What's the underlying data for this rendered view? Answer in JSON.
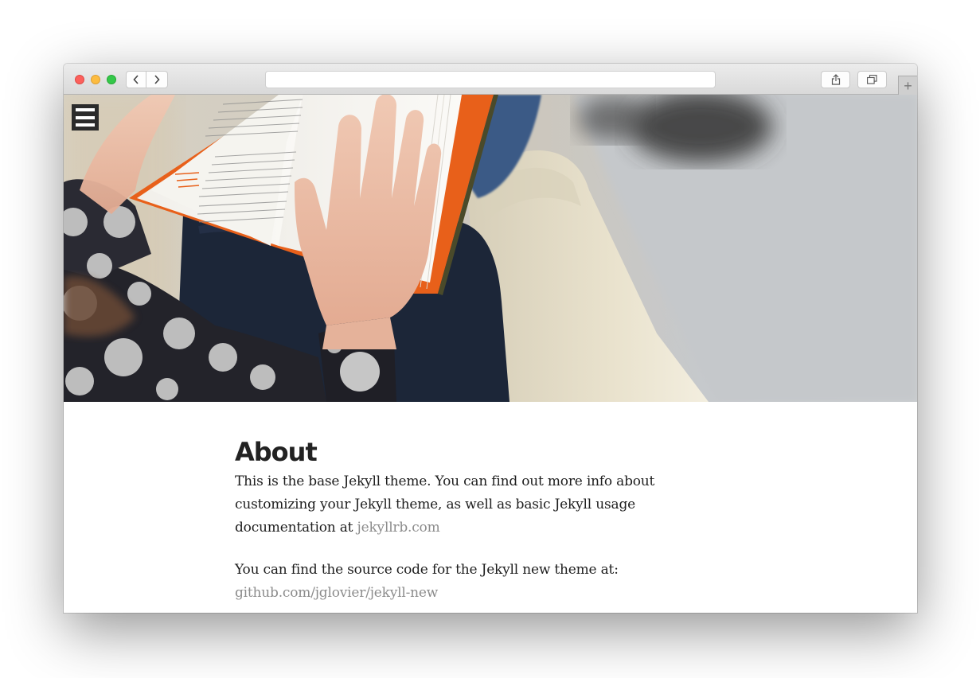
{
  "browser": {
    "address": "",
    "new_tab_symbol": "+",
    "back_icon": "chevron-left-icon",
    "forward_icon": "chevron-right-icon",
    "share_icon": "share-icon",
    "tabs_icon": "tabs-overview-icon"
  },
  "hero": {
    "image": "photo of a person reading an open book with an orange cover, sitting on a cream sofa"
  },
  "nav": {
    "menu_icon": "hamburger-menu-icon"
  },
  "article": {
    "title": "About",
    "p1_text": "This is the base Jekyll theme. You can find out more info about customizing your Jekyll theme, as well as basic Jekyll usage documentation at ",
    "p1_link": "jekyllrb.com",
    "p2_text": "You can find the source code for the Jekyll new theme at: ",
    "p2_link": "github.com/jglovier/jekyll-new"
  },
  "colors": {
    "link": "#8c8c8c",
    "text": "#1e1e1e",
    "book_cover": "#f26a1b",
    "menu_bg": "#2b2b2b"
  }
}
